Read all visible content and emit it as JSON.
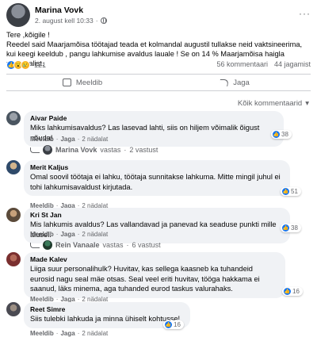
{
  "post": {
    "author": "Marina Vovk",
    "timestamp": "2. august kell 10:33",
    "more_label": "···",
    "text_line1": "Tere ,kõigile !",
    "text_line2": "Reedel said Maarjamõisa töötajad teada et kolmandal augustil tullakse neid vaktsineerima,  kui keegi keeldub , pangu lahkumise avaldus lauale ! Se on 14 % Maarjamõisa haigla personalist.",
    "reaction_count": "121",
    "comments_count": "56 kommentaari",
    "shares_count": "44 jagamist"
  },
  "actions": {
    "like_label": "Meeldib",
    "share_label": "Jaga"
  },
  "sort_label": "Kõik kommentaarid",
  "comments": [
    {
      "name": "Aivar Paide",
      "text": "Miks lahkumisavaldus? Las lasevad lahti, siis on hiljem võimalik õigust nõuda!",
      "likes": "38",
      "like_label": "Meeldib",
      "reply_label": "Jaga",
      "age": "2 nädalat",
      "replier": "Marina Vovk",
      "reply_summary": "vastas",
      "reply_count": "2 vastust"
    },
    {
      "name": "Merit Kaljus",
      "text": "Omal soovil töötaja ei lahku, töötaja sunnitakse lahkuma. Mitte mingil juhul ei tohi lahkumisavaldust kirjutada.",
      "likes": "51",
      "like_label": "Meeldib",
      "reply_label": "Jaga",
      "age": "2 nädalat"
    },
    {
      "name": "Kri St Jan",
      "text": "Mis lahkumis avaldus? Las vallandavad ja panevad ka seaduse punkti mille alusel.",
      "likes": "38",
      "like_label": "Meeldib",
      "reply_label": "Jaga",
      "age": "2 nädalat",
      "replier": "Rein Vanaale",
      "reply_summary": "vastas",
      "reply_count": "6 vastust"
    },
    {
      "name": "Made Kalev",
      "text": "Liiga suur personalihulk? Huvitav, kas sellega kaasneb ka tuhandeid eurosid nagu seal mäe otsas. Seal veel eriti huvitav, tööga hakkama ei saanud, läks minema, aga tuhanded eurod taskus valurahaks.",
      "likes": "16",
      "like_label": "Meeldib",
      "reply_label": "Jaga",
      "age": "2 nädalat"
    },
    {
      "name": "Reet Simre",
      "text": "Siis tulebki lahkuda ja minna ühiselt kohtusse!",
      "likes": "16",
      "like_label": "Meeldib",
      "reply_label": "Jaga",
      "age": "2 nädalat"
    }
  ],
  "colors": {
    "like_blue": "#1877f2",
    "bubble_bg": "#f0f2f5",
    "secondary_text": "#65676b"
  }
}
